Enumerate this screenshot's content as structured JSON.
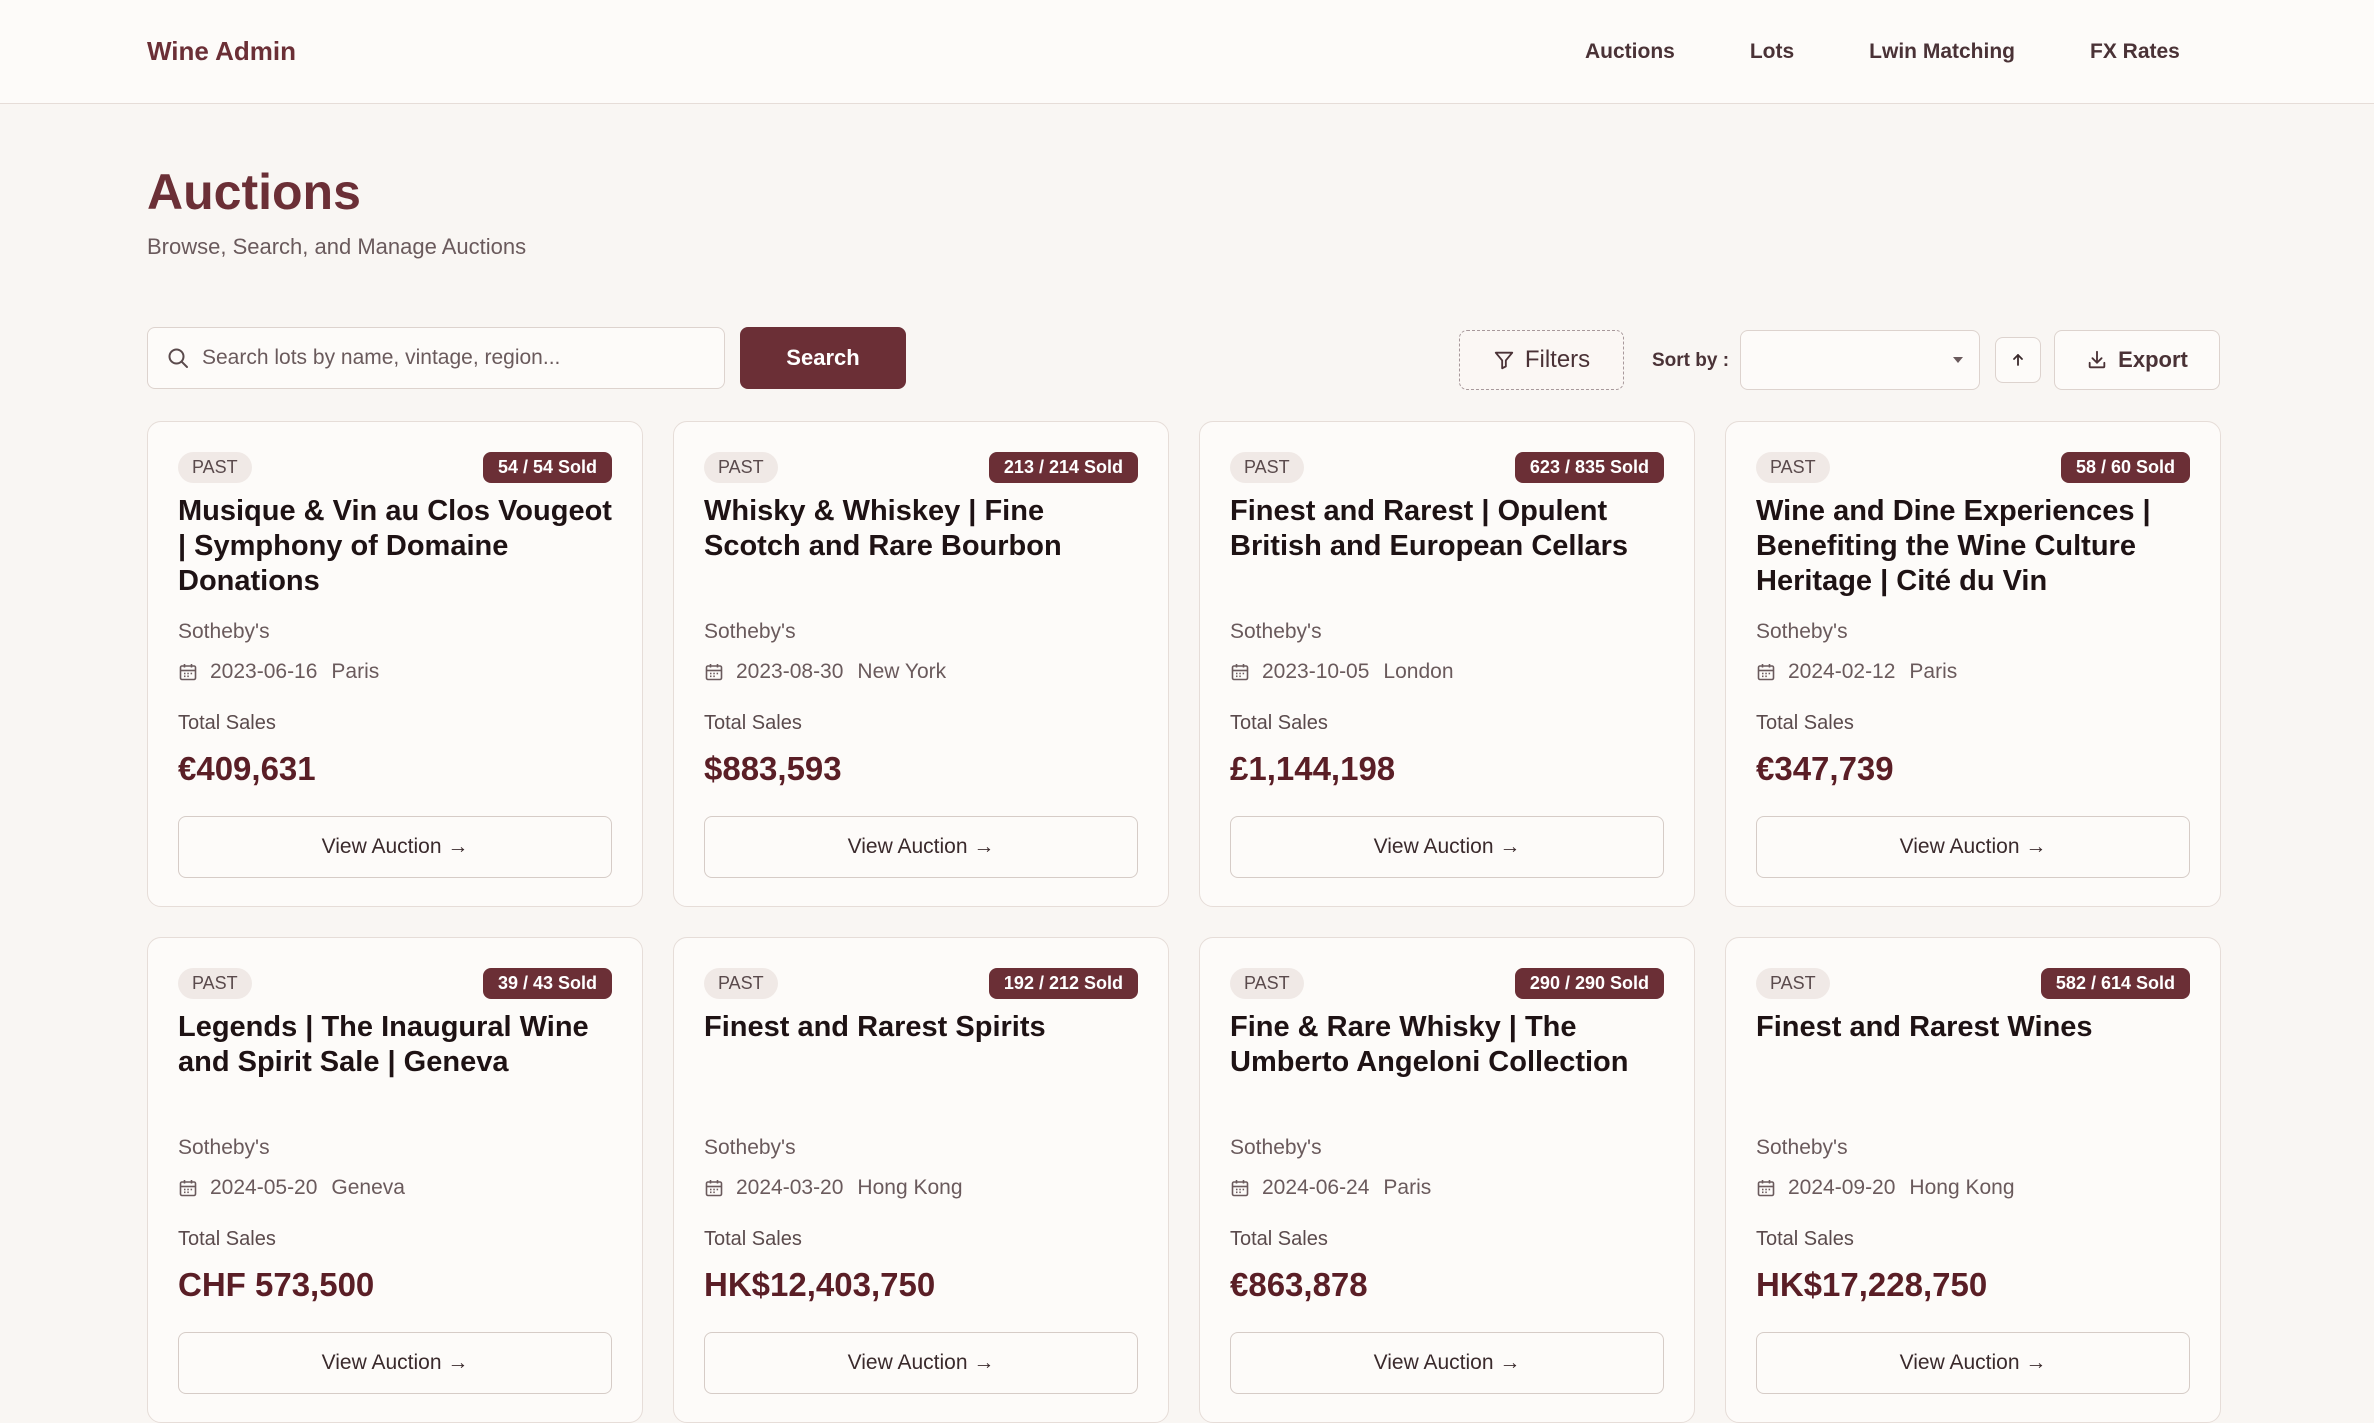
{
  "nav": {
    "brand": "Wine Admin",
    "links": [
      "Auctions",
      "Lots",
      "Lwin Matching",
      "FX Rates"
    ]
  },
  "header": {
    "title": "Auctions",
    "subtitle": "Browse, Search, and Manage Auctions"
  },
  "toolbar": {
    "search_placeholder": "Search lots by name, vintage, region...",
    "search_value": "",
    "search_button": "Search",
    "filters_button": "Filters",
    "sort_label": "Sort by :",
    "sort_value": "",
    "export_button": "Export"
  },
  "card_labels": {
    "total_sales": "Total Sales",
    "view_button": "View Auction →"
  },
  "auctions": [
    {
      "status": "PAST",
      "sold": "54 / 54 Sold",
      "title": "Musique & Vin au Clos Vougeot | Symphony of Domaine Donations",
      "house": "Sotheby's",
      "date": "2023-06-16",
      "location": "Paris",
      "total": "€409,631"
    },
    {
      "status": "PAST",
      "sold": "213 / 214 Sold",
      "title": "Whisky & Whiskey | Fine Scotch and Rare Bourbon",
      "house": "Sotheby's",
      "date": "2023-08-30",
      "location": "New York",
      "total": "$883,593"
    },
    {
      "status": "PAST",
      "sold": "623 / 835 Sold",
      "title": "Finest and Rarest | Opulent British and European Cellars",
      "house": "Sotheby's",
      "date": "2023-10-05",
      "location": "London",
      "total": "£1,144,198"
    },
    {
      "status": "PAST",
      "sold": "58 / 60 Sold",
      "title": "Wine and Dine Experiences | Benefiting the Wine Culture Heritage | Cité du Vin",
      "house": "Sotheby's",
      "date": "2024-02-12",
      "location": "Paris",
      "total": "€347,739"
    },
    {
      "status": "PAST",
      "sold": "39 / 43 Sold",
      "title": "Legends | The Inaugural Wine and Spirit Sale | Geneva",
      "house": "Sotheby's",
      "date": "2024-05-20",
      "location": "Geneva",
      "total": "CHF 573,500"
    },
    {
      "status": "PAST",
      "sold": "192 / 212 Sold",
      "title": "Finest and Rarest Spirits",
      "house": "Sotheby's",
      "date": "2024-03-20",
      "location": "Hong Kong",
      "total": "HK$12,403,750"
    },
    {
      "status": "PAST",
      "sold": "290 / 290 Sold",
      "title": "Fine & Rare Whisky | The Umberto Angeloni Collection",
      "house": "Sotheby's",
      "date": "2024-06-24",
      "location": "Paris",
      "total": "€863,878"
    },
    {
      "status": "PAST",
      "sold": "582 / 614 Sold",
      "title": "Finest and Rarest Wines",
      "house": "Sotheby's",
      "date": "2024-09-20",
      "location": "Hong Kong",
      "total": "HK$17,228,750"
    }
  ]
}
